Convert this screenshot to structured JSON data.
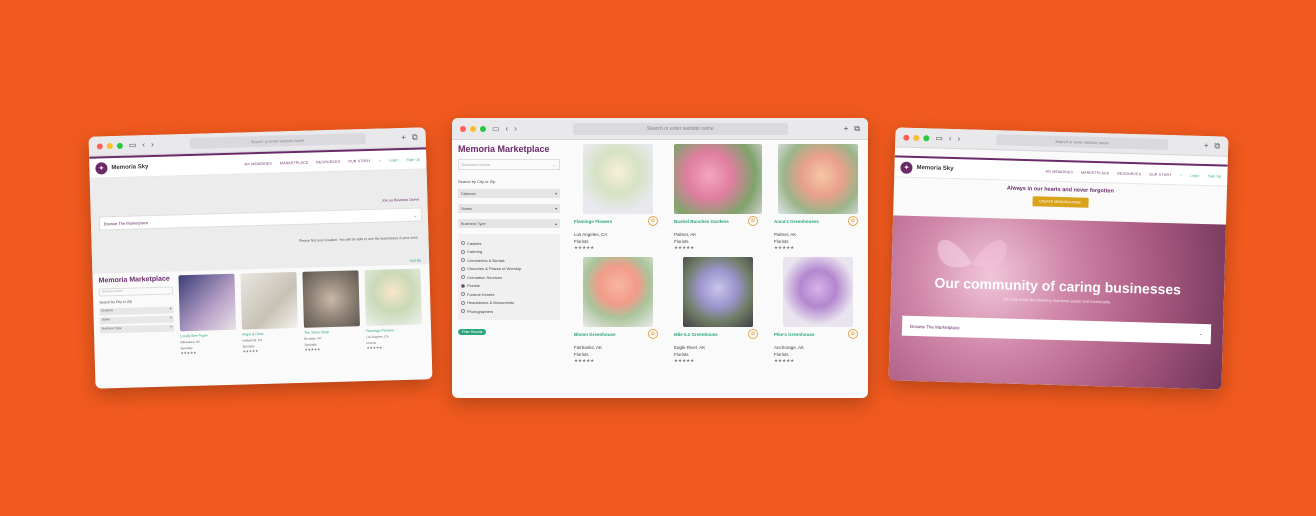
{
  "browser": {
    "address_placeholder": "Search or enter website name"
  },
  "brand": {
    "name": "Memoria Sky",
    "accent": "#6a2a6a",
    "green": "#2aa57c",
    "bg": "#f05a1e"
  },
  "nav": [
    "MY MEMORIES",
    "MARKETPLACE",
    "RESOURCES",
    "OUR STORY",
    "Login",
    "Sign Up"
  ],
  "left": {
    "cta_note": "Join as Business Owner",
    "browse": "Browse The Marketplace",
    "locate_note": "Please find your location. You will be able to see the businesses in your area.",
    "title": "Memoria Marketplace",
    "search_placeholder": "Business Name",
    "search_city": "Search by City or Zip",
    "selects": [
      "Distance",
      "States",
      "Business Type"
    ],
    "sort": "Sort By",
    "cards": [
      {
        "name": "Lovely Bee Paper",
        "meta": "Milwaukee, WI",
        "type": "Specialty",
        "stars": "★★★★★"
      },
      {
        "name": "Angel & Dove",
        "meta": "Hollywood, CA",
        "type": "Specialty",
        "stars": "★★★★★"
      },
      {
        "name": "The Silver Shop",
        "meta": "Brooklyn, NY",
        "type": "Specialty",
        "stars": "★★★★★"
      },
      {
        "name": "Flamingo Flowers",
        "meta": "Los Angeles, CA",
        "type": "Florists",
        "stars": "★★★★★"
      }
    ]
  },
  "mid": {
    "title": "Memoria Marketplace",
    "search_placeholder": "Business Name",
    "search_city": "Search by City or Zip",
    "selects": [
      "Distance",
      "States",
      "Business Type"
    ],
    "categories": [
      {
        "label": "Caskets",
        "on": false
      },
      {
        "label": "Catering",
        "on": false
      },
      {
        "label": "Cemeteries & Burials",
        "on": false
      },
      {
        "label": "Churches & Places of Worship",
        "on": false
      },
      {
        "label": "Cremation Services",
        "on": false
      },
      {
        "label": "Florists",
        "on": true
      },
      {
        "label": "Funeral Homes",
        "on": false
      },
      {
        "label": "Headstones & Monuments",
        "on": false
      },
      {
        "label": "Photographers",
        "on": false
      }
    ],
    "filter_btn": "Filter Results",
    "cards": [
      {
        "name": "Flamingo Flowers",
        "loc": "Los Angeles, CA",
        "type": "Florists",
        "stars": "★★★★★"
      },
      {
        "name": "Bushel Bunches Gardens",
        "loc": "Palmer, AK",
        "type": "Florists",
        "stars": "★★★★★"
      },
      {
        "name": "Anna's Greenhouses",
        "loc": "Palmer, AK",
        "type": "Florists",
        "stars": "★★★★★"
      },
      {
        "name": "Bloom Greenhouse",
        "loc": "Fairbanks, AK",
        "type": "Florists",
        "stars": "★★★★★"
      },
      {
        "name": "Mile 5.2 Greenhouse",
        "loc": "Eagle River, AK",
        "type": "Florists",
        "stars": "★★★★★"
      },
      {
        "name": "Pike's Greenhouse",
        "loc": "Anchorage, AK",
        "type": "Florists",
        "stars": "★★★★★"
      }
    ]
  },
  "right": {
    "tagline": "Always in our hearts and never forgotten",
    "cta": "CREATE MEMORIA PAGE",
    "headline": "Our community of caring businesses",
    "subline": "We help make the planning moments easier and memorable.",
    "browse": "Browse The Marketplace"
  }
}
